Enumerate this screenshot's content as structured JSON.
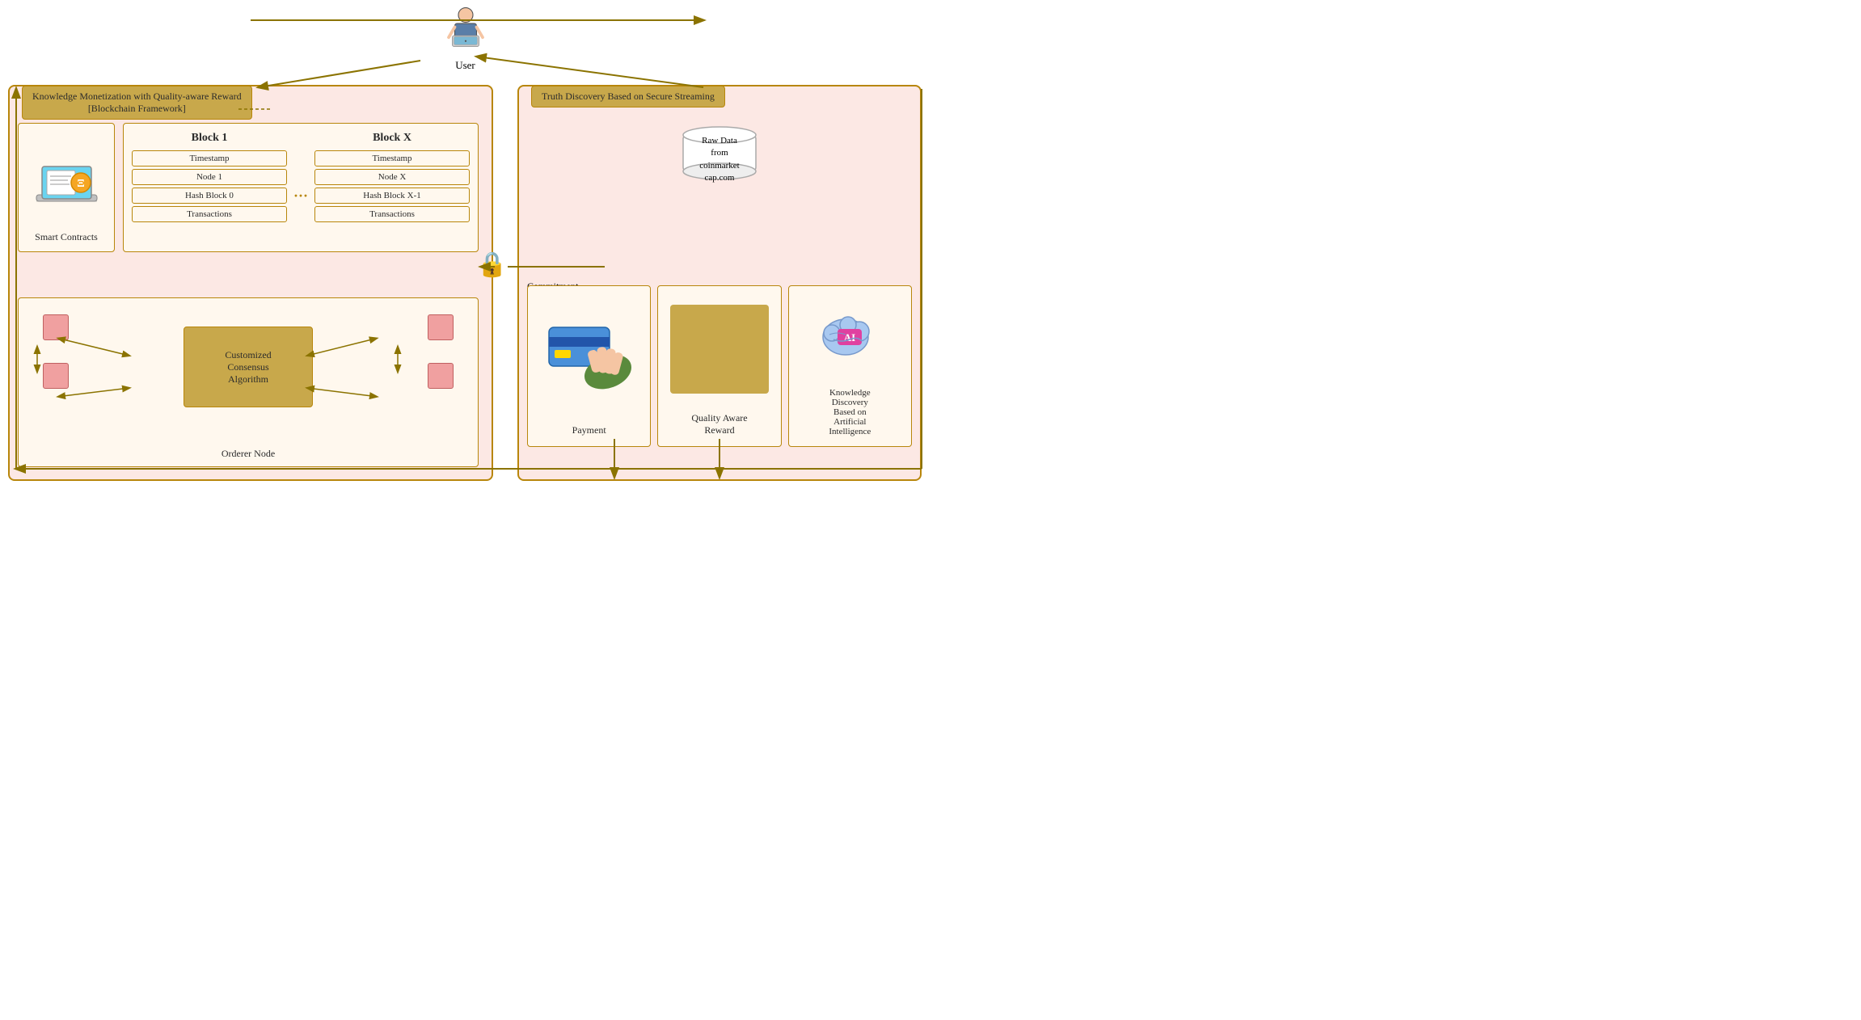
{
  "user": {
    "label": "User"
  },
  "left_frame": {
    "title_line1": "Knowledge Monetization with Quality-aware Reward",
    "title_line2": "[Blockchain Framework]",
    "smart_contracts": {
      "label": "Smart Contracts"
    },
    "block1": {
      "title": "Block 1",
      "rows": [
        "Timestamp",
        "Node 1",
        "Hash Block 0",
        "Transactions"
      ]
    },
    "blockX": {
      "title": "Block X",
      "rows": [
        "Timestamp",
        "Node X",
        "Hash Block X-1",
        "Transactions"
      ]
    },
    "orderer": {
      "label": "Orderer Node",
      "consensus": "Customized\nConsensus\nAlgorithm"
    }
  },
  "right_frame": {
    "title": "Truth Discovery Based on Secure Streaming",
    "raw_data": {
      "label": "Raw Data\nfrom\ncoinmarket\ncap.com"
    },
    "commitment": "Commitment",
    "cards": [
      {
        "label": "Payment"
      },
      {
        "label": "Quality Aware\nReward"
      },
      {
        "label": "Knowledge\nDiscovery\nBased on\nArtificial\nIntelligence"
      }
    ]
  },
  "colors": {
    "border": "#b8860b",
    "frame_bg": "#fce8e4",
    "title_bg": "#c8a84b",
    "card_bg": "#fff8ee",
    "cube": "#f0a0a0",
    "arrow": "#8b7300"
  }
}
